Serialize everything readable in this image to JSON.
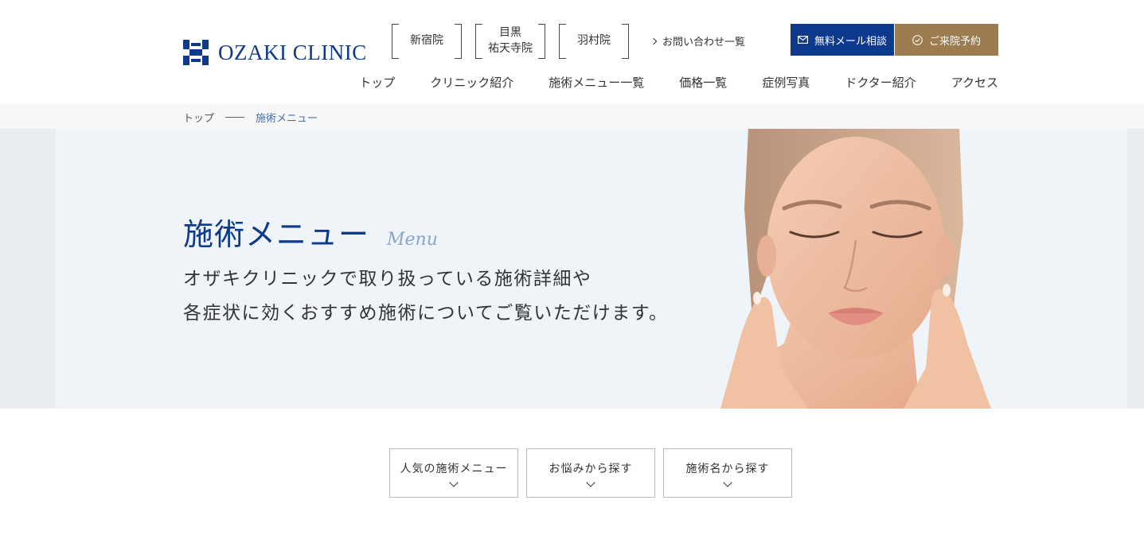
{
  "header": {
    "logo_text": "OZAKI CLINIC",
    "clinics": [
      {
        "label": "新宿院"
      },
      {
        "label": "目黒\n祐天寺院"
      },
      {
        "label": "羽村院"
      }
    ],
    "inquiry_link": "お問い合わせ一覧",
    "mail_button": "無料メール相談",
    "reserve_button": "ご来院予約",
    "nav": [
      "トップ",
      "クリニック紹介",
      "施術メニュー一覧",
      "価格一覧",
      "症例写真",
      "ドクター紹介",
      "アクセス"
    ]
  },
  "breadcrumb": {
    "home": "トップ",
    "current": "施術メニュー"
  },
  "hero": {
    "title": "施術メニュー",
    "subtitle_en": "Menu",
    "lead_line1": "オザキクリニックで取り扱っている施術詳細や",
    "lead_line2": "各症状に効くおすすめ施術についてご覧いただけます。"
  },
  "tabs": [
    {
      "label": "人気の施術メニュー"
    },
    {
      "label": "お悩みから探す"
    },
    {
      "label": "施術名から探す"
    }
  ],
  "colors": {
    "brand_blue": "#0d3a8c",
    "gold": "#9d7c4f",
    "hero_bg": "#eff4f8"
  }
}
